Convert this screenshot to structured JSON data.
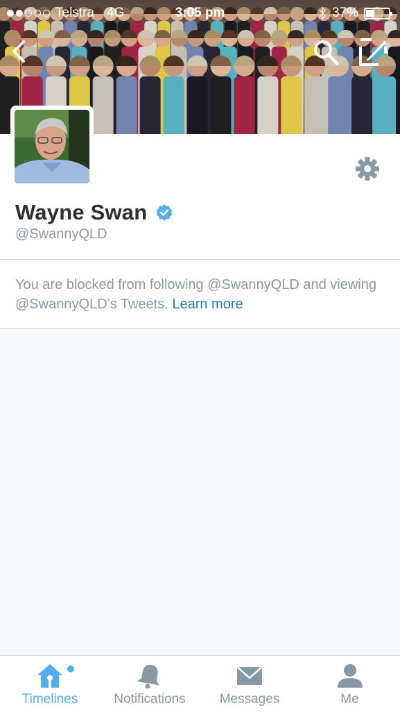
{
  "status_bar": {
    "carrier": "Telstra",
    "network": "4G",
    "time": "3:05 pm",
    "battery": "37%",
    "battery_level": 0.37,
    "signal_bars_filled": 2,
    "signal_bars_total": 5
  },
  "nav": {
    "back_icon": "chevron-left-icon",
    "search_icon": "search-icon",
    "compose_icon": "compose-icon"
  },
  "profile": {
    "name": "Wayne Swan",
    "handle": "@SwannyQLD",
    "verified": true,
    "settings_icon": "gear-icon"
  },
  "blocked": {
    "message": "You are blocked from following @SwannyQLD and viewing @SwannyQLD’s Tweets.",
    "link_label": "Learn more"
  },
  "tabs": [
    {
      "label": "Timelines",
      "icon": "house-icon",
      "active": true,
      "has_badge_dot": true
    },
    {
      "label": "Notifications",
      "icon": "bell-icon",
      "active": false
    },
    {
      "label": "Messages",
      "icon": "envelope-icon",
      "active": false
    },
    {
      "label": "Me",
      "icon": "person-icon",
      "active": false
    }
  ],
  "colors": {
    "accent": "#55acee",
    "link": "#2b7bb9",
    "muted_text": "#8899a6",
    "primary_text": "#292f33",
    "background": "#f5f8fa"
  }
}
